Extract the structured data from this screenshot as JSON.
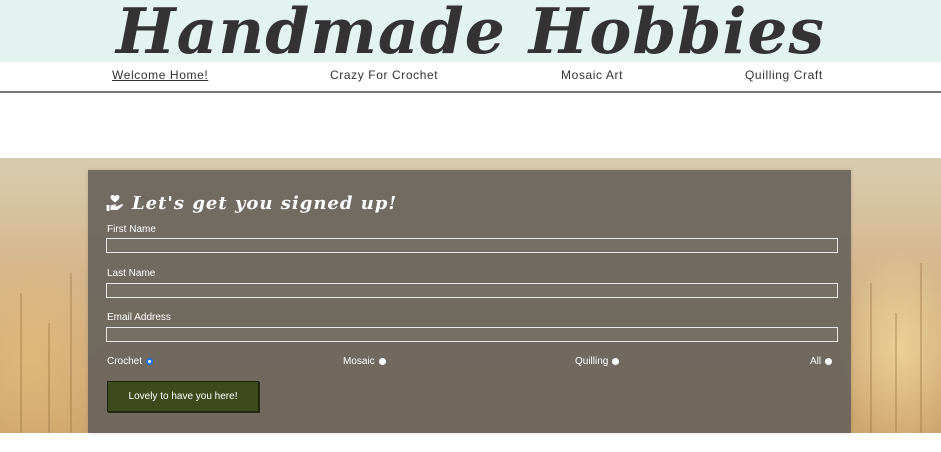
{
  "site": {
    "title": "Handmade Hobbies"
  },
  "nav": {
    "items": [
      {
        "label": "Welcome Home!",
        "active": true
      },
      {
        "label": "Crazy For Crochet",
        "active": false
      },
      {
        "label": "Mosaic Art",
        "active": false
      },
      {
        "label": "Quilling Craft",
        "active": false
      }
    ]
  },
  "form": {
    "title": "Let's get you signed up!",
    "title_icon": "heart-in-hand-icon",
    "fields": [
      {
        "label": "First Name",
        "value": ""
      },
      {
        "label": "Last Name",
        "value": ""
      },
      {
        "label": "Email Address",
        "value": ""
      }
    ],
    "radios": [
      {
        "label": "Crochet",
        "checked": true
      },
      {
        "label": "Mosaic",
        "checked": false
      },
      {
        "label": "Quilling",
        "checked": false
      },
      {
        "label": "All",
        "checked": false
      }
    ],
    "submit_label": "Lovely to have you here!"
  },
  "colors": {
    "header_bg": "#e3f3ef",
    "title_text": "#333333",
    "panel_bg": "#69645c",
    "button_bg": "#3e4a1c",
    "radio_checked": "#1a73e8"
  }
}
